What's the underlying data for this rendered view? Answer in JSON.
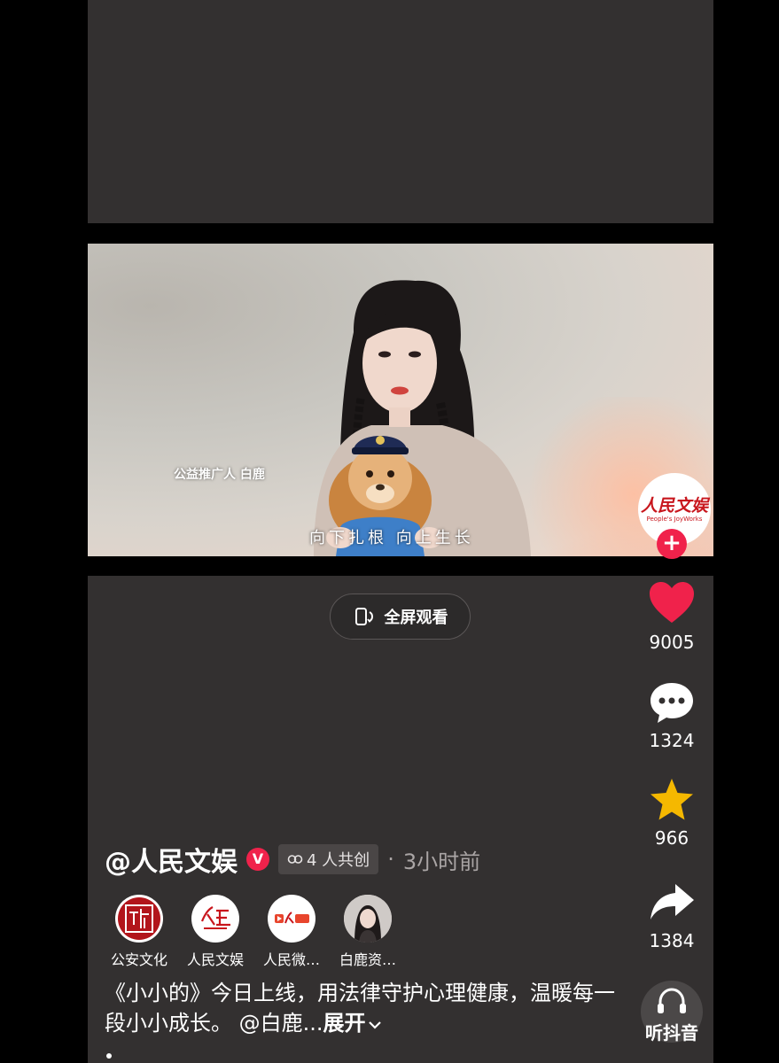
{
  "video": {
    "caption_small": "公益推广人  白鹿",
    "subtitle": "向下扎根 向上生长",
    "fullscreen_label": "全屏观看"
  },
  "brand_avatar": {
    "cn": "人民文娱",
    "en": "People's JoyWorks"
  },
  "actions": {
    "likes": "9005",
    "comments": "1324",
    "favorites": "966",
    "shares": "1384",
    "listen_label": "听抖音"
  },
  "author": {
    "name": "@人民文娱",
    "verified_mark": "V",
    "cocreate": "4 人共创",
    "separator": "·",
    "time": "3小时前"
  },
  "creators": [
    {
      "name": "公安文化"
    },
    {
      "name": "人民文娱"
    },
    {
      "name": "人民微…"
    },
    {
      "name": "白鹿资…"
    }
  ],
  "description": {
    "text": "《小小的》今日上线，用法律守护心理健康，温暖每一段小小成长。 @白鹿...",
    "more": "展开"
  },
  "colors": {
    "accent": "#f0224b",
    "star": "#f5b800",
    "panel": "#333030"
  }
}
